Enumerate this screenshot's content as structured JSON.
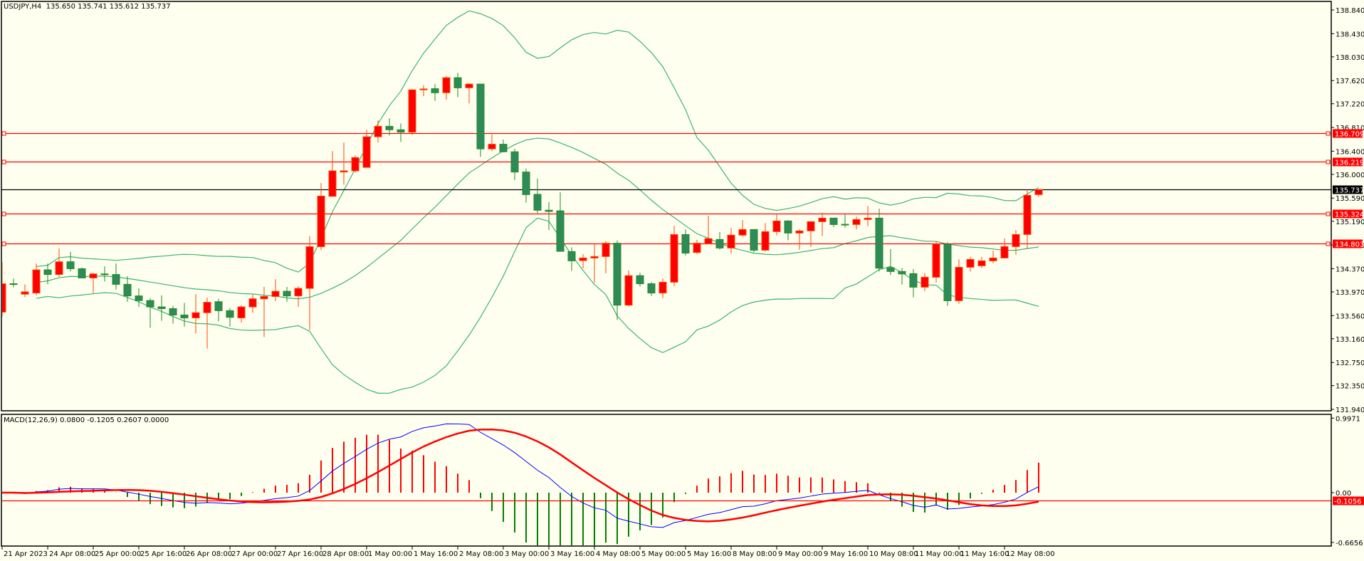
{
  "header": {
    "symbol_info": "USDJPY,H4  135.650 135.741 135.612 135.737"
  },
  "macd_header": {
    "label": "MACD(12,26,9) 0.0800 -0.1205 0.2607 0.0000"
  },
  "colors": {
    "background": "#FFFFF0",
    "bull_body": "#FF0000",
    "bull_edge": "#FF4500",
    "bear_body": "#2E8B57",
    "bear_edge": "#228B22",
    "bands": "#3CB371",
    "hline": "#FF0000",
    "bid_line": "#000000",
    "macd_line": "#0000FF",
    "signal_line": "#FF0000",
    "hist_pos": "#FF0000",
    "hist_neg": "#008000"
  },
  "chart_data": [
    {
      "type": "candlestick",
      "title": "USDJPY,H4",
      "indicators": [
        "Bollinger Bands (20,2)"
      ],
      "ylim": [
        131.94,
        138.84
      ],
      "y_ticks": [
        "138.840",
        "138.430",
        "138.030",
        "137.620",
        "137.220",
        "136.810",
        "136.400",
        "136.000",
        "135.590",
        "135.190",
        "134.780",
        "134.370",
        "133.970",
        "133.560",
        "133.160",
        "132.750",
        "132.350",
        "131.940"
      ],
      "x_ticks": [
        "21 Apr 2023",
        "24 Apr 08:00",
        "25 Apr 00:00",
        "25 Apr 16:00",
        "26 Apr 08:00",
        "27 Apr 00:00",
        "27 Apr 16:00",
        "28 Apr 08:00",
        "1 May 00:00",
        "1 May 16:00",
        "2 May 08:00",
        "3 May 00:00",
        "3 May 16:00",
        "4 May 08:00",
        "5 May 00:00",
        "5 May 16:00",
        "8 May 08:00",
        "9 May 00:00",
        "9 May 16:00",
        "10 May 08:00",
        "11 May 00:00",
        "11 May 16:00",
        "12 May 08:00"
      ],
      "bars_per_x_tick": 4,
      "horizontal_lines": [
        {
          "value": 136.709,
          "label": "136.709",
          "kind": "level"
        },
        {
          "value": 136.219,
          "label": "136.219",
          "kind": "level"
        },
        {
          "value": 135.324,
          "label": "135.324",
          "kind": "level"
        },
        {
          "value": 134.803,
          "label": "134.803",
          "kind": "level"
        },
        {
          "value": 135.737,
          "label": "135.737",
          "kind": "bid"
        }
      ],
      "ohlc": [
        [
          133.62,
          134.48,
          133.54,
          134.11
        ],
        [
          134.11,
          134.2,
          134.05,
          134.1
        ],
        [
          133.93,
          134.1,
          133.88,
          133.97
        ],
        [
          133.95,
          134.46,
          133.91,
          134.35
        ],
        [
          134.35,
          134.46,
          134.1,
          134.27
        ],
        [
          134.27,
          134.72,
          134.23,
          134.49
        ],
        [
          134.49,
          134.66,
          134.32,
          134.37
        ],
        [
          134.37,
          134.39,
          134.21,
          134.21
        ],
        [
          134.21,
          134.3,
          133.95,
          134.28
        ],
        [
          134.28,
          134.41,
          134.15,
          134.27
        ],
        [
          134.27,
          134.46,
          134.01,
          134.1
        ],
        [
          134.1,
          134.24,
          133.8,
          133.9
        ],
        [
          133.9,
          134.03,
          133.71,
          133.82
        ],
        [
          133.82,
          133.86,
          133.35,
          133.71
        ],
        [
          133.71,
          133.91,
          133.47,
          133.68
        ],
        [
          133.68,
          133.73,
          133.42,
          133.57
        ],
        [
          133.57,
          133.78,
          133.37,
          133.52
        ],
        [
          133.52,
          133.93,
          133.25,
          133.61
        ],
        [
          133.61,
          133.87,
          132.99,
          133.79
        ],
        [
          133.8,
          133.85,
          133.46,
          133.645
        ],
        [
          133.645,
          133.69,
          133.37,
          133.53
        ],
        [
          133.52,
          133.74,
          133.44,
          133.71
        ],
        [
          133.71,
          133.92,
          133.61,
          133.85
        ],
        [
          133.85,
          134.055,
          133.19,
          133.89
        ],
        [
          133.89,
          134.19,
          133.81,
          133.98
        ],
        [
          133.98,
          134.055,
          133.8,
          133.9
        ],
        [
          133.9,
          134.07,
          133.71,
          134.03
        ],
        [
          134.03,
          134.93,
          133.31,
          134.75
        ],
        [
          134.75,
          135.85,
          134.69,
          135.625
        ],
        [
          135.62,
          136.4,
          135.62,
          136.06
        ],
        [
          136.04,
          136.55,
          135.82,
          136.06
        ],
        [
          136.06,
          136.33,
          136.03,
          136.29
        ],
        [
          136.12,
          136.77,
          136.12,
          136.65
        ],
        [
          136.65,
          136.93,
          136.55,
          136.83
        ],
        [
          136.83,
          136.97,
          136.67,
          136.77
        ],
        [
          136.77,
          136.88,
          136.56,
          136.73
        ],
        [
          136.73,
          137.475,
          136.68,
          137.46
        ],
        [
          137.46,
          137.54,
          137.35,
          137.475
        ],
        [
          137.48,
          137.56,
          137.27,
          137.41
        ],
        [
          137.41,
          137.7,
          137.29,
          137.67
        ],
        [
          137.67,
          137.75,
          137.335,
          137.495
        ],
        [
          137.495,
          137.575,
          137.225,
          137.56
        ],
        [
          137.56,
          137.56,
          136.3,
          136.44
        ],
        [
          136.44,
          136.69,
          136.4,
          136.52
        ],
        [
          136.52,
          136.6,
          136.38,
          136.39
        ],
        [
          136.39,
          136.44,
          135.9,
          136.04
        ],
        [
          136.04,
          136.1,
          135.51,
          135.65
        ],
        [
          135.655,
          135.925,
          135.33,
          135.38
        ],
        [
          135.38,
          135.52,
          135.04,
          135.36
        ],
        [
          135.37,
          135.69,
          134.67,
          134.67
        ],
        [
          134.666,
          134.74,
          134.334,
          134.506
        ],
        [
          134.51,
          134.62,
          134.375,
          134.555
        ],
        [
          134.555,
          134.8,
          134.13,
          134.58
        ],
        [
          134.58,
          134.85,
          134.29,
          134.81
        ],
        [
          134.81,
          134.86,
          133.485,
          133.74
        ],
        [
          133.74,
          134.34,
          133.72,
          134.25
        ],
        [
          134.25,
          134.3,
          134.06,
          134.11
        ],
        [
          134.11,
          134.14,
          133.9,
          133.95
        ],
        [
          133.95,
          134.2,
          133.86,
          134.137
        ],
        [
          134.137,
          135.11,
          134.07,
          134.96
        ],
        [
          134.96,
          135.05,
          134.6,
          134.64
        ],
        [
          134.65,
          134.87,
          134.625,
          134.81
        ],
        [
          134.8,
          135.285,
          134.8,
          134.89
        ],
        [
          134.875,
          135.002,
          134.7,
          134.727
        ],
        [
          134.727,
          135.076,
          134.63,
          134.95
        ],
        [
          134.95,
          135.21,
          134.924,
          135.047
        ],
        [
          135.047,
          135.047,
          134.654,
          134.69
        ],
        [
          134.69,
          135.16,
          134.666,
          135.01
        ],
        [
          135.01,
          135.318,
          134.945,
          135.195
        ],
        [
          135.195,
          135.207,
          134.86,
          134.986
        ],
        [
          134.986,
          135.05,
          134.7,
          135.023
        ],
        [
          135.023,
          135.183,
          134.748,
          135.183
        ],
        [
          135.183,
          135.34,
          134.937,
          135.244
        ],
        [
          135.244,
          135.244,
          135.09,
          135.133
        ],
        [
          135.137,
          135.31,
          135.08,
          135.133
        ],
        [
          135.133,
          135.27,
          135.047,
          135.22
        ],
        [
          135.22,
          135.453,
          135.105,
          135.244
        ],
        [
          135.244,
          135.408,
          134.322,
          134.379
        ],
        [
          134.387,
          134.707,
          134.26,
          134.322
        ],
        [
          134.322,
          134.383,
          134.096,
          134.28
        ],
        [
          134.285,
          134.363,
          133.875,
          134.051
        ],
        [
          134.051,
          134.297,
          133.985,
          134.223
        ],
        [
          134.223,
          134.838,
          134.133,
          134.793
        ],
        [
          134.793,
          134.83,
          133.727,
          133.817
        ],
        [
          133.817,
          134.53,
          133.764,
          134.395
        ],
        [
          134.395,
          134.572,
          134.318,
          134.531
        ],
        [
          134.42,
          134.572,
          134.379,
          134.506
        ],
        [
          134.506,
          134.682,
          134.465,
          134.555
        ],
        [
          134.555,
          134.892,
          134.555,
          134.752
        ],
        [
          134.752,
          135.039,
          134.613,
          134.961
        ],
        [
          134.961,
          135.736,
          134.711,
          135.638
        ],
        [
          135.65,
          135.741,
          135.612,
          135.737
        ]
      ]
    },
    {
      "type": "line",
      "title": "MACD(12,26,9)",
      "ylim": [
        -0.6656,
        0.9971
      ],
      "y_ticks": [
        "0.9971",
        "0.00",
        "-0.6656"
      ],
      "level": {
        "value": -0.1056,
        "label": "-0.1056"
      },
      "params": {
        "fast": 12,
        "slow": 26,
        "signal": 9
      },
      "last_values": [
        0.08,
        -0.1205,
        0.2607,
        0.0
      ]
    }
  ]
}
